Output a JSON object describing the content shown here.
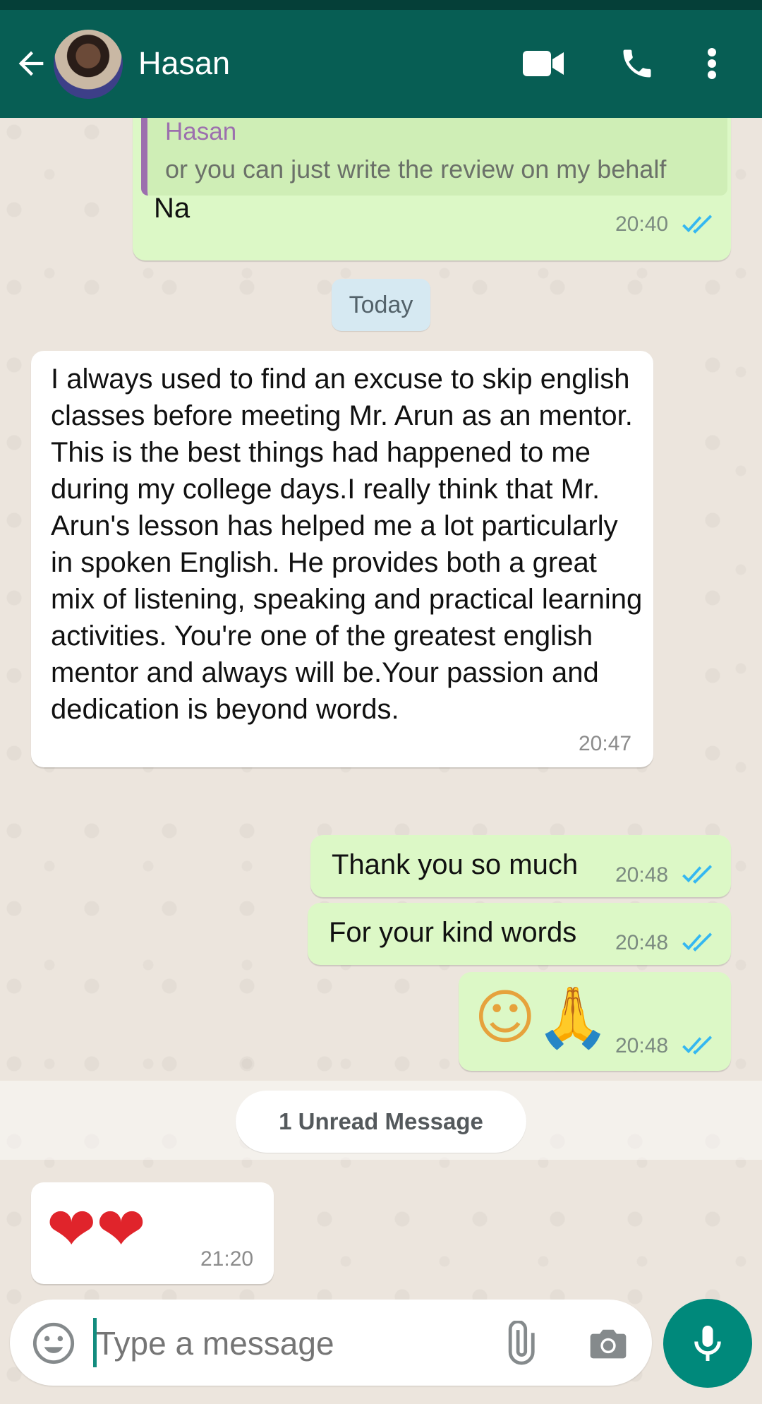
{
  "header": {
    "contact_name": "Hasan",
    "back_icon": "arrow-left-icon",
    "video_icon": "video-camera-icon",
    "call_icon": "phone-icon",
    "menu_icon": "more-vertical-icon"
  },
  "messages": {
    "m1": {
      "reply_name": "Hasan",
      "reply_text": "or you can just write the review on my behalf",
      "text": "Na",
      "time": "20:40",
      "status": "read"
    },
    "date_chip": "Today",
    "m2": {
      "text": "I always used to find an excuse to skip english classes before meeting Mr. Arun as an mentor. This is the best things had happened to me during my college days.I really think that Mr. Arun's lesson has helped me a lot particularly in spoken English. He provides both a great mix of listening, speaking and practical learning activities. You're one of the greatest english mentor and always will be.Your passion and dedication is beyond words.",
      "time": "20:47"
    },
    "m3": {
      "text": "Thank you so much",
      "time": "20:48",
      "status": "read"
    },
    "m4": {
      "text": "For your kind words",
      "time": "20:48",
      "status": "read"
    },
    "m5": {
      "emoji": "☺🙏",
      "time": "20:48",
      "status": "read"
    },
    "unread_label": "1 Unread Message",
    "m6": {
      "emoji": "❤❤",
      "time": "21:20"
    }
  },
  "composer": {
    "placeholder": "Type a message",
    "emoji_icon": "smiley-icon",
    "attach_icon": "paperclip-icon",
    "camera_icon": "camera-icon",
    "mic_icon": "microphone-icon"
  },
  "colors": {
    "header": "#075e54",
    "outgoing_bubble": "#dcf8c6",
    "incoming_bubble": "#ffffff",
    "read_ticks": "#34b7f1",
    "mic_button": "#00897b"
  }
}
